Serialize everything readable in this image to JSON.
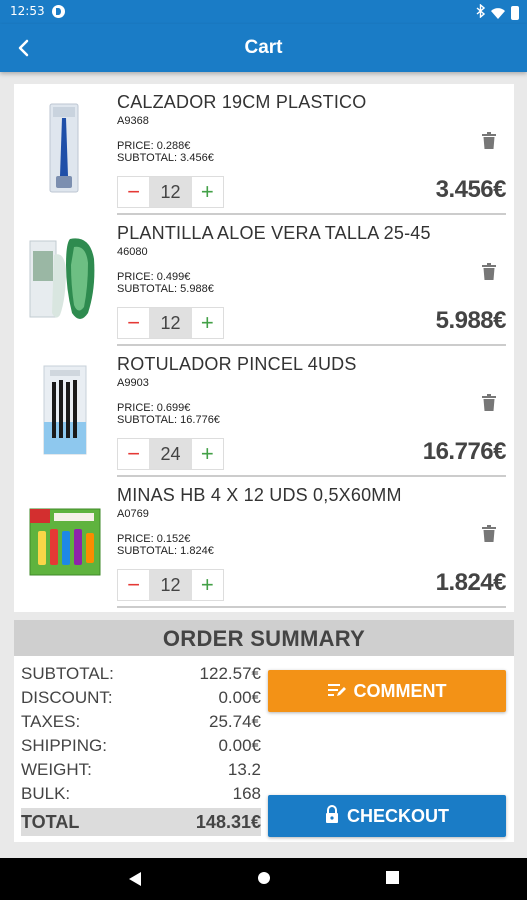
{
  "status_bar": {
    "time": "12:53"
  },
  "app_bar": {
    "title": "Cart"
  },
  "cart": {
    "items": [
      {
        "name": "CALZADOR 19CM PLASTICO",
        "ref": "A9368",
        "price": "PRICE: 0.288€",
        "subtotal": "SUBTOTAL: 3.456€",
        "qty": "12",
        "total": "3.456€"
      },
      {
        "name": "PLANTILLA ALOE VERA TALLA 25-45",
        "ref": "46080",
        "price": "PRICE: 0.499€",
        "subtotal": "SUBTOTAL: 5.988€",
        "qty": "12",
        "total": "5.988€"
      },
      {
        "name": "ROTULADOR PINCEL 4UDS",
        "ref": "A9903",
        "price": "PRICE: 0.699€",
        "subtotal": "SUBTOTAL: 16.776€",
        "qty": "24",
        "total": "16.776€"
      },
      {
        "name": "MINAS HB 4 X 12 UDS 0,5X60MM",
        "ref": "A0769",
        "price": "PRICE: 0.152€",
        "subtotal": "SUBTOTAL: 1.824€",
        "qty": "12",
        "total": "1.824€"
      }
    ]
  },
  "summary": {
    "title": "ORDER SUMMARY",
    "rows": [
      {
        "label": "SUBTOTAL:",
        "value": "122.57€"
      },
      {
        "label": "DISCOUNT:",
        "value": "0.00€"
      },
      {
        "label": "TAXES:",
        "value": "25.74€"
      },
      {
        "label": "SHIPPING:",
        "value": "0.00€"
      },
      {
        "label": "WEIGHT:",
        "value": "13.2"
      },
      {
        "label": "BULK:",
        "value": "168"
      }
    ],
    "total": {
      "label": "TOTAL",
      "value": "148.31€"
    },
    "comment_label": "COMMENT",
    "checkout_label": "CHECKOUT"
  },
  "colors": {
    "primary": "#1a7cc6",
    "accent": "#f39216",
    "minus": "#e53935",
    "plus": "#43a047"
  }
}
